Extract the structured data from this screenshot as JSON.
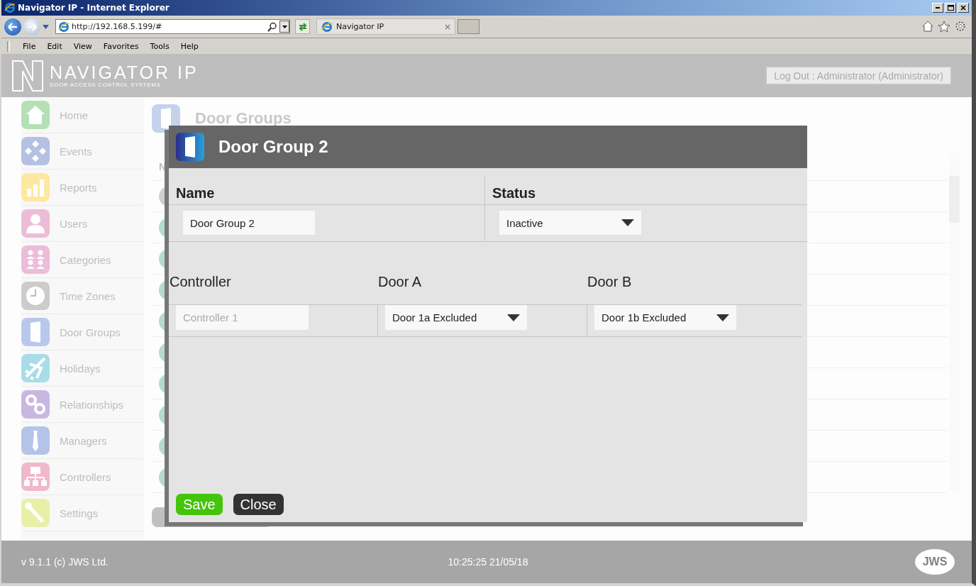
{
  "browser": {
    "title": "Navigator IP - Internet Explorer",
    "address": "http://192.168.5.199/#",
    "tab": "Navigator IP",
    "menu": [
      "File",
      "Edit",
      "View",
      "Favorites",
      "Tools",
      "Help"
    ]
  },
  "header": {
    "logo_title": "NAVIGATOR IP",
    "logo_subtitle": "DOOR ACCESS CONTROL SYSTEMS",
    "logout": "Log Out : Administrator (Administrator)"
  },
  "sidebar": {
    "items": [
      {
        "label": "Home",
        "kind": "home",
        "color": "#b5dfb5"
      },
      {
        "label": "Events",
        "kind": "events",
        "color": "#b4c0e4"
      },
      {
        "label": "Reports",
        "kind": "reports",
        "color": "#fde8a0"
      },
      {
        "label": "Users",
        "kind": "users",
        "color": "#ecbcd8"
      },
      {
        "label": "Categories",
        "kind": "categories",
        "color": "#ecbcd8"
      },
      {
        "label": "Time Zones",
        "kind": "time",
        "color": "#cccccc"
      },
      {
        "label": "Door Groups",
        "kind": "door",
        "color": "#b8c8ec"
      },
      {
        "label": "Holidays",
        "kind": "holidays",
        "color": "#a8dce8"
      },
      {
        "label": "Relationships",
        "kind": "relationships",
        "color": "#c8b8e0"
      },
      {
        "label": "Managers",
        "kind": "managers",
        "color": "#b4c4e8"
      },
      {
        "label": "Controllers",
        "kind": "controllers",
        "color": "#f0b8c8"
      },
      {
        "label": "Settings",
        "kind": "settings",
        "color": "#e8f0a8"
      }
    ]
  },
  "page": {
    "title": "Door Groups",
    "column_1": "N",
    "rows": [
      {
        "color": "#d0d0d0"
      },
      {
        "color": "#b4dcc8"
      },
      {
        "color": "#b4dcc8"
      },
      {
        "color": "#b4dcc8"
      },
      {
        "color": "#b4dcc8"
      },
      {
        "color": "#b4dcc8"
      },
      {
        "color": "#b4dcc8"
      },
      {
        "color": "#b4dcc8"
      },
      {
        "color": "#b4dcc8"
      },
      {
        "color": "#b4dcc8"
      }
    ]
  },
  "dialog": {
    "title": "Door Group 2",
    "name_label": "Name",
    "name_value": "Door Group 2",
    "status_label": "Status",
    "status_value": "Inactive",
    "columns": [
      "Controller",
      "Door A",
      "Door B"
    ],
    "row": {
      "controller": "Controller 1",
      "controller_disabled": true,
      "door_a": "Door 1a Excluded",
      "door_b": "Door 1b Excluded"
    },
    "buttons": [
      {
        "label": "Save",
        "kind": "primary"
      },
      {
        "label": "Close",
        "kind": "secondary"
      }
    ]
  },
  "footer": {
    "version": "v 9.1.1 (c) JWS Ltd.",
    "time": "10:25:25 21/05/18",
    "logo": "JWS"
  }
}
